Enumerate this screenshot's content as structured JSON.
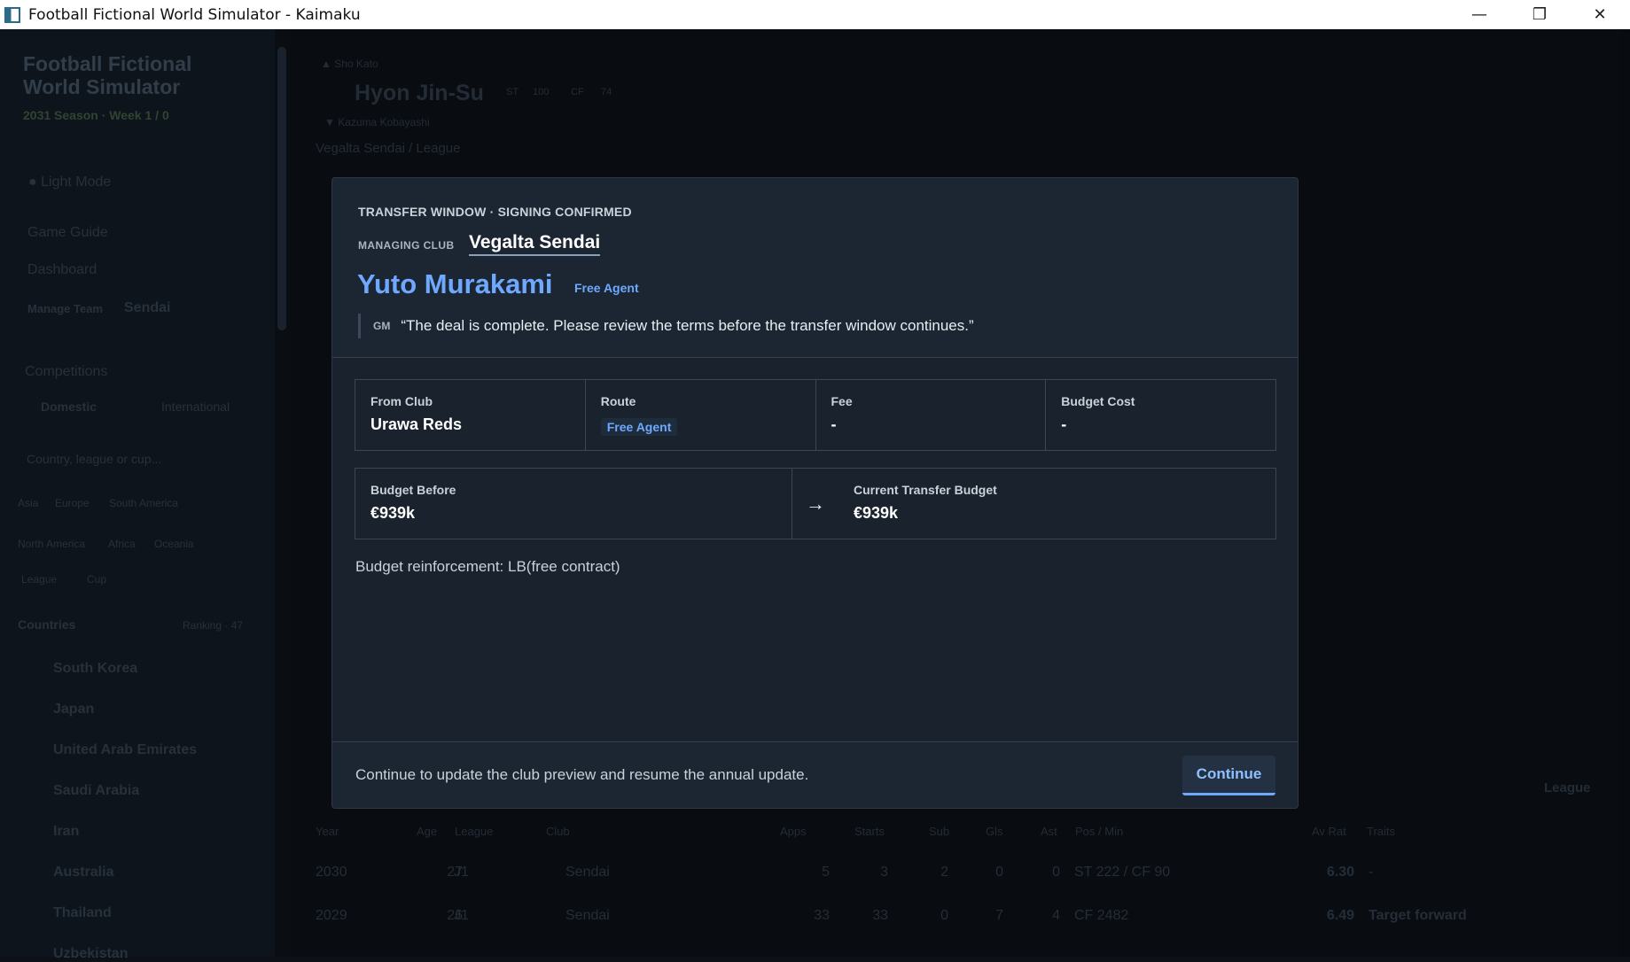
{
  "window": {
    "title": "Football Fictional World Simulator - Kaimaku",
    "minimize": "—",
    "restore": "❐",
    "close": "✕"
  },
  "sidebar": {
    "app_title_line1": "Football Fictional",
    "app_title_line2": "World Simulator",
    "season": "2031 Season · Week 1 / 0",
    "light_mode": "Light Mode",
    "nav": [
      "Game Guide",
      "Dashboard"
    ],
    "manage_team_label": "Manage Team",
    "manage_team_value": "Sendai",
    "competitions": "Competitions",
    "tabs": [
      "Domestic",
      "International"
    ],
    "search_placeholder": "Country, league or cup...",
    "regions_row1": [
      "Asia",
      "Europe",
      "South America"
    ],
    "regions_row2": [
      "North America",
      "Africa",
      "Oceania"
    ],
    "legend": [
      "League",
      "Cup"
    ],
    "countries_header": "Countries",
    "ranking": "Ranking · 47",
    "countries": [
      "South Korea",
      "Japan",
      "United Arab Emirates",
      "Saudi Arabia",
      "Iran",
      "Australia",
      "Thailand",
      "Uzbekistan"
    ]
  },
  "background": {
    "prev_player": "▲ Sho Kato",
    "player_name": "Hyon Jin-Su",
    "badges": [
      "ST",
      "100",
      "CF",
      "74"
    ],
    "next_player": "▼ Kazuma Kobayashi",
    "club_path": "Vegalta Sendai / League",
    "table_headers": [
      "Year",
      "Age",
      "League",
      "Club",
      "Apps",
      "Starts",
      "Sub",
      "Gls",
      "Ast",
      "Pos / Min",
      "Av Rat",
      "Traits"
    ],
    "rows": [
      [
        "2030",
        "27",
        "J1",
        "Sendai",
        "5",
        "3",
        "2",
        "0",
        "0",
        "ST 222 / CF 90",
        "6.30",
        "-"
      ],
      [
        "2029",
        "26",
        "J1",
        "Sendai",
        "33",
        "33",
        "0",
        "7",
        "4",
        "CF 2482",
        "6.49",
        "Target forward"
      ]
    ],
    "league_label": "League"
  },
  "modal": {
    "kicker": "TRANSFER WINDOW · SIGNING CONFIRMED",
    "club_label": "MANAGING CLUB",
    "club_name": "Vegalta Sendai",
    "player": "Yuto Murakami",
    "tag": "Free Agent",
    "gm_label": "GM",
    "quote": "“The deal is complete. Please review the terms before the transfer window continues.”",
    "details": {
      "from_club_label": "From Club",
      "from_club": "Urawa Reds",
      "route_label": "Route",
      "route": "Free Agent",
      "fee_label": "Fee",
      "fee": "-",
      "budget_cost_label": "Budget Cost",
      "budget_cost": "-"
    },
    "budget": {
      "before_label": "Budget Before",
      "before": "€939k",
      "arrow": "→",
      "current_label": "Current Transfer Budget",
      "current": "€939k"
    },
    "note": "Budget reinforcement: LB(free contract)",
    "footer_text": "Continue to update the club preview and resume the annual update.",
    "continue": "Continue"
  }
}
